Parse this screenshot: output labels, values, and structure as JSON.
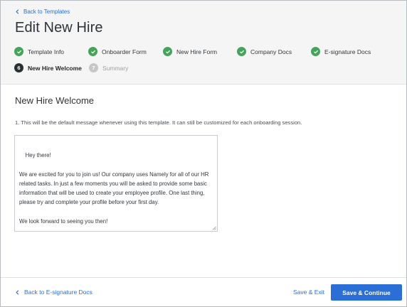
{
  "header": {
    "back_label": "Back to Templates",
    "title": "Edit New Hire"
  },
  "steps": [
    {
      "label": "Template Info",
      "state": "done",
      "icon": "check-icon"
    },
    {
      "label": "Onboarder Form",
      "state": "done",
      "icon": "check-icon"
    },
    {
      "label": "New Hire Form",
      "state": "done",
      "icon": "check-icon"
    },
    {
      "label": "Company Docs",
      "state": "done",
      "icon": "check-icon"
    },
    {
      "label": "E-signature Docs",
      "state": "done",
      "icon": "check-icon"
    },
    {
      "label": "New Hire Welcome",
      "state": "current",
      "number": "6"
    },
    {
      "label": "Summary",
      "state": "pending",
      "number": "7"
    }
  ],
  "main": {
    "section_title": "New Hire Welcome",
    "instruction": "1. This will be the default message whenever using this template. It can still be customized for each onboarding session.",
    "message": "Hey there!\n\nWe are excited for you to join us! Our company uses Namely for all of our HR related tasks. In just a few moments you will be asked to provide some basic information that will be used to create your employee profile. One last thing, please try and complete your profile before your first day.\n\nWe look forward to seeing you then!"
  },
  "footer": {
    "back_label": "Back to E-signature Docs",
    "save_exit_label": "Save & Exit",
    "save_continue_label": "Save & Continue"
  },
  "colors": {
    "accent": "#2b6fd6",
    "done": "#46a35a",
    "current": "#2b2f33",
    "pending": "#c5c7c9"
  }
}
